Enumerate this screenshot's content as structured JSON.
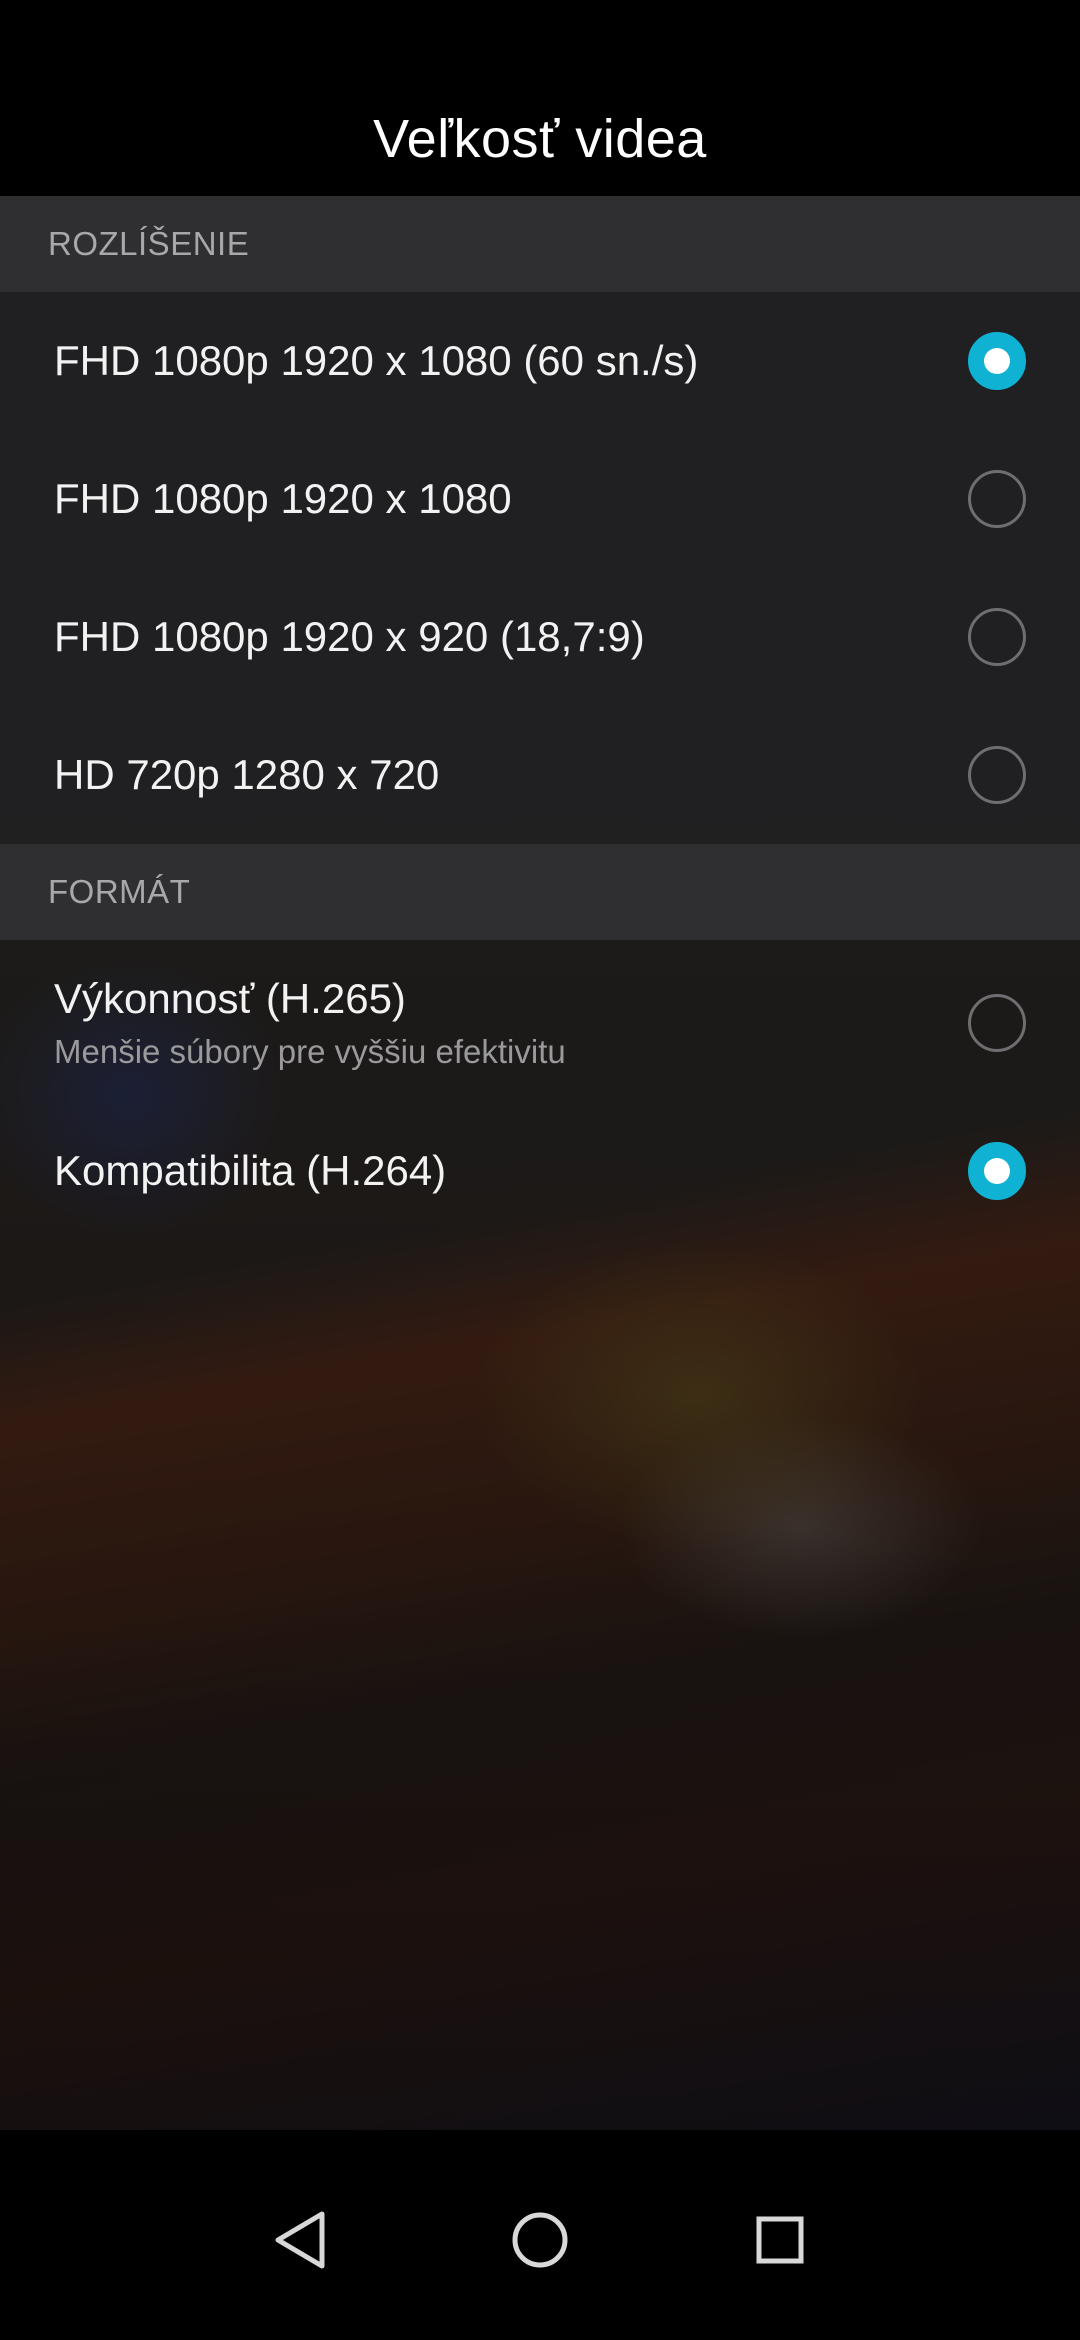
{
  "header": {
    "title": "Veľkosť videa"
  },
  "sections": {
    "resolution": {
      "title": "ROZLÍŠENIE",
      "options": [
        {
          "label": "FHD 1080p 1920 x 1080 (60 sn./s)",
          "checked": true
        },
        {
          "label": "FHD 1080p 1920 x 1080",
          "checked": false
        },
        {
          "label": "FHD 1080p 1920 x 920 (18,7:9)",
          "checked": false
        },
        {
          "label": "HD 720p 1280 x 720",
          "checked": false
        }
      ]
    },
    "format": {
      "title": "FORMÁT",
      "options": [
        {
          "label": "Výkonnosť (H.265)",
          "sublabel": "Menšie súbory pre vyššiu efektivitu",
          "checked": false
        },
        {
          "label": "Kompatibilita (H.264)",
          "checked": true
        }
      ]
    }
  },
  "colors": {
    "accent": "#0fb2d3",
    "section_header_bg": "#2f2f31"
  },
  "navbar": {
    "icons": [
      "back-icon",
      "home-icon",
      "recents-icon"
    ]
  }
}
